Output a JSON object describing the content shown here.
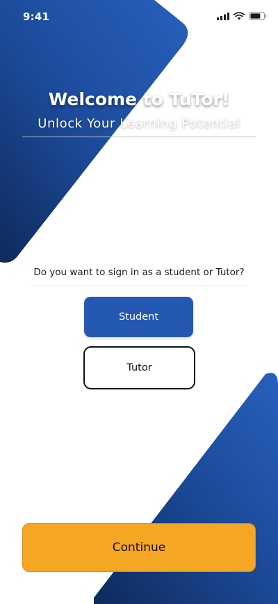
{
  "status_bar": {
    "time": "9:41"
  },
  "header": {
    "title": "Welcome to TuTor!",
    "tagline": "Unlock Your Learning Potential"
  },
  "role_selection": {
    "question": "Do you want to sign in as a student or Tutor?",
    "student_label": "Student",
    "tutor_label": "Tutor"
  },
  "footer": {
    "continue_label": "Continue"
  },
  "colors": {
    "brand_blue": "#2458b3",
    "dark_blue": "#0e2a5c",
    "accent_orange": "#f5a623"
  },
  "icons": [
    "cellular-signal-icon",
    "wifi-icon",
    "battery-icon"
  ]
}
